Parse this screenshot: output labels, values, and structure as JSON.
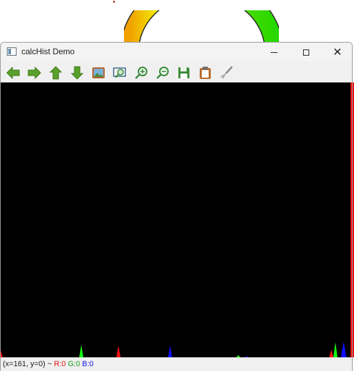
{
  "window": {
    "title": "calcHist Demo"
  },
  "toolbar": {
    "tools": [
      {
        "name": "back-arrow-icon",
        "color": "#5aa02c"
      },
      {
        "name": "forward-arrow-icon",
        "color": "#5aa02c"
      },
      {
        "name": "up-arrow-icon",
        "color": "#5aa02c"
      },
      {
        "name": "down-arrow-icon",
        "color": "#5aa02c"
      },
      {
        "name": "image-icon",
        "color": "#b8602a"
      },
      {
        "name": "zoom-window-icon",
        "color": "#3a8a3a"
      },
      {
        "name": "zoom-in-icon",
        "color": "#3a8a3a"
      },
      {
        "name": "zoom-out-icon",
        "color": "#3a8a3a"
      },
      {
        "name": "save-icon",
        "color": "#3a8a3a"
      },
      {
        "name": "clipboard-icon",
        "color": "#b86a2a"
      },
      {
        "name": "brush-icon",
        "color": "#9a9a9a"
      }
    ]
  },
  "status": {
    "coords": "(x=161, y=0) ~",
    "r": "R:0",
    "g": "G:0",
    "b": "B:0"
  },
  "colors": {
    "red_channel": "#ff1010",
    "green_channel": "#10ff10",
    "blue_channel": "#1010ff"
  }
}
